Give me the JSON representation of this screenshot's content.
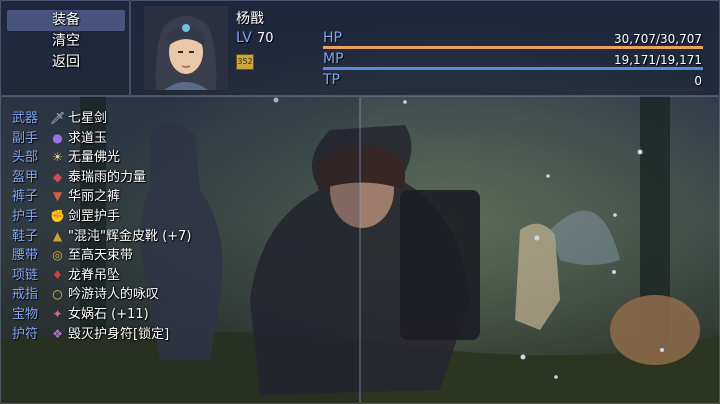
{
  "menu": {
    "items": [
      {
        "label": "装备",
        "selected": true
      },
      {
        "label": "清空",
        "selected": false
      },
      {
        "label": "返回",
        "selected": false
      }
    ]
  },
  "character": {
    "name": "杨戬",
    "level_label": "LV",
    "level": "70",
    "badge": "352"
  },
  "stats": {
    "hp": {
      "label": "HP",
      "value": "30,707/30,707",
      "fill": 1.0,
      "color": "#e8a060"
    },
    "mp": {
      "label": "MP",
      "value": "19,171/19,171",
      "fill": 1.0,
      "color": "#5a8ae0"
    },
    "tp": {
      "label": "TP",
      "value": "0",
      "fill": 0.0,
      "color": "#40b080"
    }
  },
  "equipment": [
    {
      "slot": "武器",
      "item": "七星剑",
      "icon": "sword-icon"
    },
    {
      "slot": "副手",
      "item": "求道玉",
      "icon": "orb-icon"
    },
    {
      "slot": "头部",
      "item": "无量佛光",
      "icon": "halo-icon"
    },
    {
      "slot": "盔甲",
      "item": "泰瑞雨的力量",
      "icon": "armor-icon"
    },
    {
      "slot": "裤子",
      "item": "华丽之裤",
      "icon": "pants-icon"
    },
    {
      "slot": "护手",
      "item": "剑罡护手",
      "icon": "gauntlet-icon"
    },
    {
      "slot": "鞋子",
      "item": "\"混沌\"辉金皮靴 (+7)",
      "icon": "boots-icon"
    },
    {
      "slot": "腰带",
      "item": "至高天束带",
      "icon": "belt-icon"
    },
    {
      "slot": "项链",
      "item": "龙脊吊坠",
      "icon": "pendant-icon"
    },
    {
      "slot": "戒指",
      "item": "吟游诗人的咏叹",
      "icon": "ring-icon"
    },
    {
      "slot": "宝物",
      "item": "女娲石 (+11)",
      "icon": "stone-icon"
    },
    {
      "slot": "护符",
      "item": "毁灭护身符[锁定]",
      "icon": "amulet-icon"
    }
  ],
  "colors": {
    "label_blue": "#80a4f0",
    "text_white": "#ffffff"
  }
}
